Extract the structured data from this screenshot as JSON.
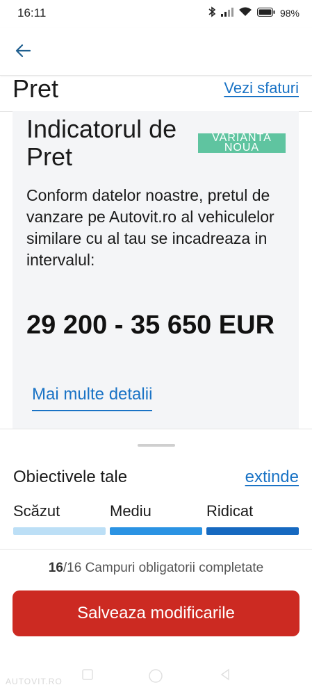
{
  "status_bar": {
    "time": "16:11",
    "battery": "98%",
    "icons": [
      "bluetooth-icon",
      "signal-icon",
      "wifi-icon",
      "battery-icon"
    ]
  },
  "app_bar": {
    "back_icon": "arrow-left-icon"
  },
  "section": {
    "title": "Pret",
    "tips_link": "Vezi sfaturi"
  },
  "card": {
    "title": "Indicatorul de Pret",
    "badge": "VARIANTA NOUA",
    "description": "Conform datelor noastre, pretul de vanzare pe Autovit.ro al vehiculelor similare cu al tau se incadreaza in intervalul:",
    "price_range": "29 200 - 35 650 EUR",
    "details_link": "Mai multe detalii"
  },
  "goals": {
    "title": "Obiectivele tale",
    "expand_link": "extinde",
    "levels": [
      {
        "label": "Scăzut",
        "color": "#bcdff6"
      },
      {
        "label": "Mediu",
        "color": "#2b93e3"
      },
      {
        "label": "Ridicat",
        "color": "#1669c0"
      }
    ]
  },
  "footer": {
    "fields_completed": "16",
    "fields_total": "/16 Campuri obligatorii completate",
    "save_button": "Salveaza modificarile",
    "watermark": "AUTOVIT.RO"
  },
  "colors": {
    "accent_link": "#1a73c5",
    "primary_button": "#cc2a22",
    "badge": "#5fc4a0",
    "card_bg": "#f4f5f7"
  }
}
